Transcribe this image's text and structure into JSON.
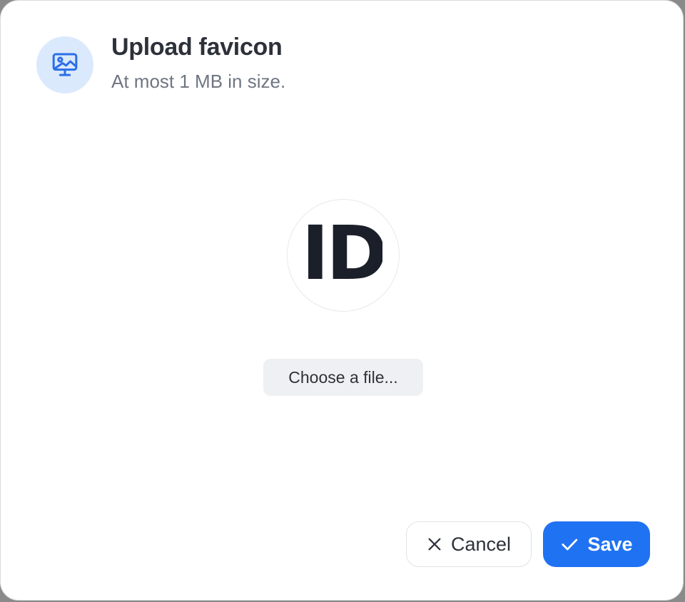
{
  "dialog": {
    "title": "Upload favicon",
    "subtitle": "At most 1 MB in size.",
    "header_icon": "monitor-image-icon",
    "preview": {
      "text": "ID",
      "color": "#1b1f2a"
    },
    "choose_file_label": "Choose a file...",
    "cancel_label": "Cancel",
    "cancel_icon": "close-icon",
    "save_label": "Save",
    "save_icon": "check-icon"
  },
  "colors": {
    "accent": "#1f72f2",
    "icon_bg": "#dbe9fd",
    "icon_stroke": "#2b6fe6"
  }
}
